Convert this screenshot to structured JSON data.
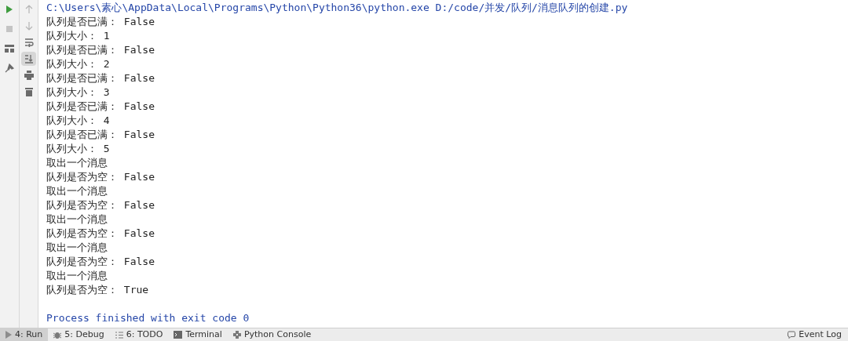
{
  "toolbar_left": [
    {
      "kind": "run",
      "disabled": false
    },
    {
      "kind": "stop",
      "disabled": true
    },
    {
      "kind": "layout",
      "disabled": false
    },
    {
      "kind": "pin",
      "disabled": false
    }
  ],
  "toolbar_right": [
    {
      "kind": "up",
      "selected": false
    },
    {
      "kind": "down",
      "selected": false
    },
    {
      "kind": "wrap",
      "selected": false
    },
    {
      "kind": "scroll-end",
      "selected": true
    },
    {
      "kind": "print",
      "selected": false
    },
    {
      "kind": "trash",
      "selected": false
    }
  ],
  "console": [
    {
      "kind": "command",
      "text": "C:\\Users\\素心\\AppData\\Local\\Programs\\Python\\Python36\\python.exe D:/code/并发/队列/消息队列的创建.py"
    },
    {
      "kind": "output",
      "text": "队列是否已满： False"
    },
    {
      "kind": "output",
      "text": "队列大小： 1"
    },
    {
      "kind": "output",
      "text": "队列是否已满： False"
    },
    {
      "kind": "output",
      "text": "队列大小： 2"
    },
    {
      "kind": "output",
      "text": "队列是否已满： False"
    },
    {
      "kind": "output",
      "text": "队列大小： 3"
    },
    {
      "kind": "output",
      "text": "队列是否已满： False"
    },
    {
      "kind": "output",
      "text": "队列大小： 4"
    },
    {
      "kind": "output",
      "text": "队列是否已满： False"
    },
    {
      "kind": "output",
      "text": "队列大小： 5"
    },
    {
      "kind": "output",
      "text": "取出一个消息"
    },
    {
      "kind": "output",
      "text": "队列是否为空： False"
    },
    {
      "kind": "output",
      "text": "取出一个消息"
    },
    {
      "kind": "output",
      "text": "队列是否为空： False"
    },
    {
      "kind": "output",
      "text": "取出一个消息"
    },
    {
      "kind": "output",
      "text": "队列是否为空： False"
    },
    {
      "kind": "output",
      "text": "取出一个消息"
    },
    {
      "kind": "output",
      "text": "队列是否为空： False"
    },
    {
      "kind": "output",
      "text": "取出一个消息"
    },
    {
      "kind": "output",
      "text": "队列是否为空： True"
    },
    {
      "kind": "exit",
      "text": "Process finished with exit code 0"
    }
  ],
  "tool_windows": [
    {
      "kind": "run",
      "label": "4: Run",
      "selected": true
    },
    {
      "kind": "debug",
      "label": "5: Debug",
      "selected": false
    },
    {
      "kind": "todo",
      "label": "6: TODO",
      "selected": false
    },
    {
      "kind": "terminal",
      "label": "Terminal",
      "selected": false
    },
    {
      "kind": "console",
      "label": "Python Console",
      "selected": false
    }
  ],
  "event_log": {
    "label": "Event Log"
  }
}
